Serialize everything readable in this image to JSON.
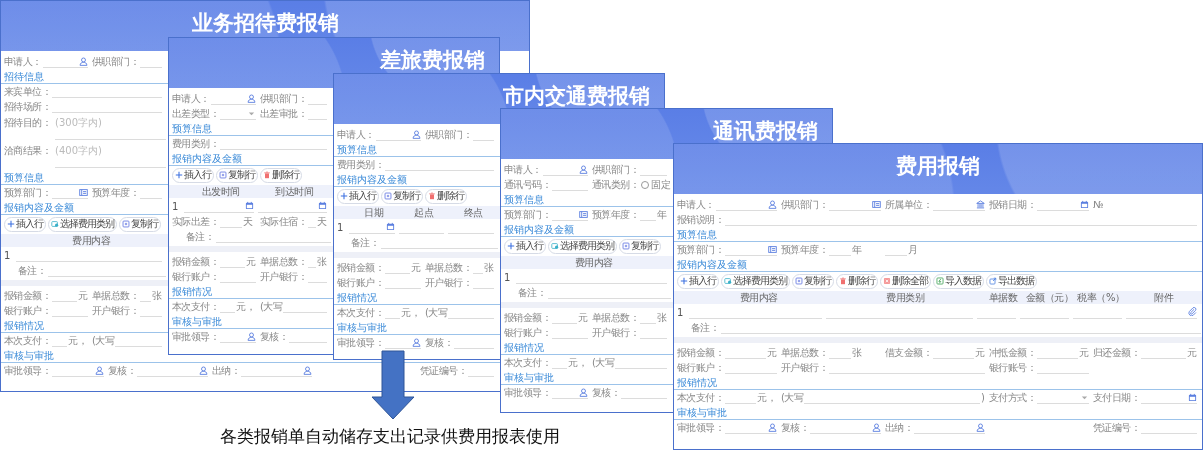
{
  "forms": [
    {
      "title": "业务招待费报销",
      "kind": "full",
      "rows": [
        {
          "kind": "fields",
          "items": [
            {
              "kind": "person",
              "label": "申请人："
            },
            {
              "label": "供职部门："
            }
          ]
        },
        {
          "kind": "section",
          "title": "招待信息"
        },
        {
          "kind": "fields",
          "items": [
            {
              "kind": "full",
              "label": "来宾单位："
            }
          ]
        },
        {
          "kind": "fields",
          "items": [
            {
              "kind": "full",
              "label": "招待场所："
            }
          ]
        },
        {
          "kind": "textarea",
          "label": "招待目的：",
          "placeholder": "(300字内)"
        },
        {
          "kind": "textarea",
          "label": "洽商结果：",
          "placeholder": "(400字内)"
        },
        {
          "kind": "section",
          "title": "预算信息"
        },
        {
          "kind": "fields",
          "items": [
            {
              "kind": "org",
              "label": "预算部门："
            },
            {
              "label": "预算年度："
            }
          ]
        },
        {
          "kind": "section",
          "title": "报销内容及金额"
        },
        {
          "kind": "toolbar",
          "buttons": [
            {
              "kind": "insert",
              "label": "插入行"
            },
            {
              "kind": "category",
              "label": "选择费用类别"
            },
            {
              "kind": "copy",
              "label": "复制行"
            }
          ]
        },
        {
          "kind": "table",
          "number": "1",
          "columns": [
            {
              "label": "费用内容"
            }
          ]
        },
        {
          "kind": "remark",
          "label": "备注："
        },
        {
          "kind": "band"
        },
        {
          "kind": "fields",
          "items": [
            {
              "label": "报销金额：",
              "unit": "元"
            },
            {
              "kind": "short",
              "label": "单据总数：",
              "unit": "张"
            }
          ]
        },
        {
          "kind": "fields",
          "items": [
            {
              "label": "银行账户："
            },
            {
              "label": "开户银行："
            }
          ]
        },
        {
          "kind": "section",
          "title": "报销情况"
        },
        {
          "kind": "fields",
          "items": [
            {
              "label": "本次支付：",
              "unit": "元，"
            },
            {
              "kind": "wide",
              "label": "(大写"
            }
          ]
        },
        {
          "kind": "section",
          "title": "审核与审批"
        },
        {
          "kind": "fields",
          "items": [
            {
              "kind": "person",
              "label": "审批领导："
            },
            {
              "kind": "person",
              "label": "复核："
            },
            {
              "kind": "person",
              "label": "出纳："
            },
            {
              "kind": "empty"
            },
            {
              "label": "凭证编号："
            }
          ]
        }
      ]
    },
    {
      "title": "差旅费报销",
      "kind": "cropped",
      "rows": [
        {
          "kind": "fields",
          "items": [
            {
              "kind": "person",
              "label": "申请人："
            },
            {
              "label": "供职部门："
            }
          ]
        },
        {
          "kind": "fields",
          "items": [
            {
              "kind": "select",
              "label": "出差类型："
            },
            {
              "label": "出差审批："
            }
          ]
        },
        {
          "kind": "section",
          "title": "预算信息"
        },
        {
          "kind": "fields",
          "items": [
            {
              "kind": "full",
              "label": "费用类别："
            }
          ]
        },
        {
          "kind": "section",
          "title": "报销内容及金额"
        },
        {
          "kind": "toolbar",
          "buttons": [
            {
              "kind": "insert",
              "label": "插入行"
            },
            {
              "kind": "copy",
              "label": "复制行"
            },
            {
              "kind": "delete",
              "label": "删除行"
            }
          ]
        },
        {
          "kind": "table",
          "number": "1",
          "columns": [
            {
              "kind": "date",
              "label": "出发时间"
            },
            {
              "kind": "date",
              "label": "到达时间"
            }
          ]
        },
        {
          "kind": "fields",
          "items": [
            {
              "kind": "short",
              "label": "实际出差：",
              "unit": "天"
            },
            {
              "kind": "short",
              "label": "实际住宿：",
              "unit": "天"
            }
          ]
        },
        {
          "kind": "remark",
          "label": "备注："
        },
        {
          "kind": "band"
        },
        {
          "kind": "fields",
          "items": [
            {
              "label": "报销金额：",
              "unit": "元"
            },
            {
              "kind": "short",
              "label": "单据总数：",
              "unit": "张"
            }
          ]
        },
        {
          "kind": "fields",
          "items": [
            {
              "label": "银行账户："
            },
            {
              "label": "开户银行："
            }
          ]
        },
        {
          "kind": "section",
          "title": "报销情况"
        },
        {
          "kind": "fields",
          "items": [
            {
              "label": "本次支付：",
              "unit": "元，"
            },
            {
              "kind": "wide",
              "label": "(大写"
            }
          ]
        },
        {
          "kind": "section",
          "title": "审核与审批"
        },
        {
          "kind": "fields",
          "items": [
            {
              "kind": "person",
              "label": "审批领导："
            },
            {
              "label": "复核："
            }
          ]
        }
      ]
    },
    {
      "title": "市内交通费报销",
      "kind": "cropped",
      "rows": [
        {
          "kind": "fields",
          "items": [
            {
              "kind": "person",
              "label": "申请人："
            },
            {
              "label": "供职部门："
            }
          ]
        },
        {
          "kind": "section",
          "title": "预算信息"
        },
        {
          "kind": "fields",
          "items": [
            {
              "kind": "full",
              "label": "费用类别："
            }
          ]
        },
        {
          "kind": "section",
          "title": "报销内容及金额"
        },
        {
          "kind": "toolbar",
          "buttons": [
            {
              "kind": "insert",
              "label": "插入行"
            },
            {
              "kind": "copy",
              "label": "复制行"
            },
            {
              "kind": "delete",
              "label": "删除行"
            }
          ]
        },
        {
          "kind": "table",
          "number": "1",
          "columns": [
            {
              "kind": "date",
              "label": "日期"
            },
            {
              "label": "起点"
            },
            {
              "label": "终点"
            }
          ]
        },
        {
          "kind": "remark",
          "label": "备注："
        },
        {
          "kind": "band"
        },
        {
          "kind": "fields",
          "items": [
            {
              "label": "报销金额：",
              "unit": "元"
            },
            {
              "kind": "short",
              "label": "单据总数：",
              "unit": "张"
            }
          ]
        },
        {
          "kind": "fields",
          "items": [
            {
              "label": "银行账户："
            },
            {
              "label": "开户银行："
            }
          ]
        },
        {
          "kind": "section",
          "title": "报销情况"
        },
        {
          "kind": "fields",
          "items": [
            {
              "label": "本次支付：",
              "unit": "元，"
            },
            {
              "kind": "wide",
              "label": "(大写"
            }
          ]
        },
        {
          "kind": "section",
          "title": "审核与审批"
        },
        {
          "kind": "fields",
          "items": [
            {
              "kind": "person",
              "label": "审批领导："
            },
            {
              "label": "复核："
            }
          ]
        }
      ]
    },
    {
      "title": "通讯费报销",
      "kind": "cropped",
      "rows": [
        {
          "kind": "fields",
          "items": [
            {
              "kind": "person",
              "label": "申请人："
            },
            {
              "label": "供职部门："
            }
          ]
        },
        {
          "kind": "fields",
          "items": [
            {
              "label": "通讯号码："
            },
            {
              "kind": "radio",
              "label": "通讯类别：",
              "options": [
                {
                  "label": "固定",
                  "selected": false
                }
              ]
            }
          ]
        },
        {
          "kind": "section",
          "title": "预算信息"
        },
        {
          "kind": "fields",
          "items": [
            {
              "kind": "org",
              "label": "预算部门："
            },
            {
              "kind": "short",
              "label": "预算年度：",
              "unit": "年"
            }
          ]
        },
        {
          "kind": "section",
          "title": "报销内容及金额"
        },
        {
          "kind": "toolbar",
          "buttons": [
            {
              "kind": "insert",
              "label": "插入行"
            },
            {
              "kind": "category",
              "label": "选择费用类别"
            },
            {
              "kind": "copy",
              "label": "复制行"
            }
          ]
        },
        {
          "kind": "table",
          "number": "1",
          "columns": [
            {
              "label": "费用内容"
            }
          ]
        },
        {
          "kind": "remark",
          "label": "备注："
        },
        {
          "kind": "band"
        },
        {
          "kind": "fields",
          "items": [
            {
              "label": "报销金额：",
              "unit": "元"
            },
            {
              "kind": "short",
              "label": "单据总数：",
              "unit": "张"
            }
          ]
        },
        {
          "kind": "fields",
          "items": [
            {
              "label": "银行账户："
            },
            {
              "label": "开户银行："
            }
          ]
        },
        {
          "kind": "section",
          "title": "报销情况"
        },
        {
          "kind": "fields",
          "items": [
            {
              "label": "本次支付：",
              "unit": "元，"
            },
            {
              "kind": "wide",
              "label": "(大写"
            }
          ]
        },
        {
          "kind": "section",
          "title": "审核与审批"
        },
        {
          "kind": "fields",
          "items": [
            {
              "kind": "person",
              "label": "审批领导："
            },
            {
              "label": "复核："
            }
          ]
        }
      ]
    },
    {
      "title": "费用报销",
      "kind": "full",
      "rows": [
        {
          "kind": "fields",
          "items": [
            {
              "kind": "person",
              "label": "申请人："
            },
            {
              "kind": "org",
              "label": "供职部门："
            },
            {
              "kind": "bank",
              "label": "所属单位："
            },
            {
              "kind": "date",
              "label": "报销日期："
            },
            {
              "kind": "text",
              "label": "№"
            }
          ]
        },
        {
          "kind": "fields",
          "items": [
            {
              "kind": "full",
              "label": "报销说明："
            }
          ]
        },
        {
          "kind": "section",
          "title": "预算信息"
        },
        {
          "kind": "fields",
          "items": [
            {
              "kind": "org",
              "label": "预算部门："
            },
            {
              "kind": "short",
              "label": "预算年度：",
              "unit": "年"
            },
            {
              "kind": "short",
              "unit": "月"
            }
          ]
        },
        {
          "kind": "section",
          "title": "报销内容及金额"
        },
        {
          "kind": "toolbar",
          "buttons": [
            {
              "kind": "insert",
              "label": "插入行"
            },
            {
              "kind": "category",
              "label": "选择费用类别"
            },
            {
              "kind": "copy",
              "label": "复制行"
            },
            {
              "kind": "delete",
              "label": "删除行"
            },
            {
              "kind": "delete_all",
              "label": "删除全部"
            },
            {
              "kind": "import",
              "label": "导入数据"
            },
            {
              "kind": "export",
              "label": "导出数据"
            }
          ]
        },
        {
          "kind": "table",
          "number": "1",
          "columns": [
            {
              "label": "费用内容"
            },
            {
              "label": "费用类别"
            },
            {
              "label": "单据数"
            },
            {
              "label": "金额（元）"
            },
            {
              "label": "税率（%）"
            },
            {
              "kind": "attachment",
              "label": "附件"
            }
          ]
        },
        {
          "kind": "remark",
          "label": "备注："
        },
        {
          "kind": "band"
        },
        {
          "kind": "fields",
          "items": [
            {
              "label": "报销金额：",
              "unit": "元"
            },
            {
              "kind": "short",
              "label": "单据总数：",
              "unit": "张"
            },
            {
              "label": "借支金额：",
              "unit": "元"
            },
            {
              "label": "冲抵金额：",
              "unit": "元"
            },
            {
              "label": "归还金额：",
              "unit": "元"
            }
          ]
        },
        {
          "kind": "fields",
          "items": [
            {
              "label": "银行账户："
            },
            {
              "kind": "wide",
              "label": "开户银行："
            },
            {
              "label": "银行账号："
            }
          ]
        },
        {
          "kind": "section",
          "title": "报销情况"
        },
        {
          "kind": "fields",
          "items": [
            {
              "label": "本次支付：",
              "unit": "元，"
            },
            {
              "kind": "wide",
              "label": "(大写",
              "unit": ")"
            },
            {
              "kind": "select",
              "label": "支付方式："
            },
            {
              "kind": "date",
              "label": "支付日期："
            }
          ]
        },
        {
          "kind": "section",
          "title": "审核与审批"
        },
        {
          "kind": "fields",
          "items": [
            {
              "kind": "person",
              "label": "审批领导："
            },
            {
              "kind": "person",
              "label": "复核："
            },
            {
              "kind": "person",
              "label": "出纳："
            },
            {
              "kind": "empty"
            },
            {
              "label": "凭证编号："
            }
          ]
        }
      ]
    }
  ],
  "caption": "各类报销单自动储存支出记录供费用报表使用"
}
